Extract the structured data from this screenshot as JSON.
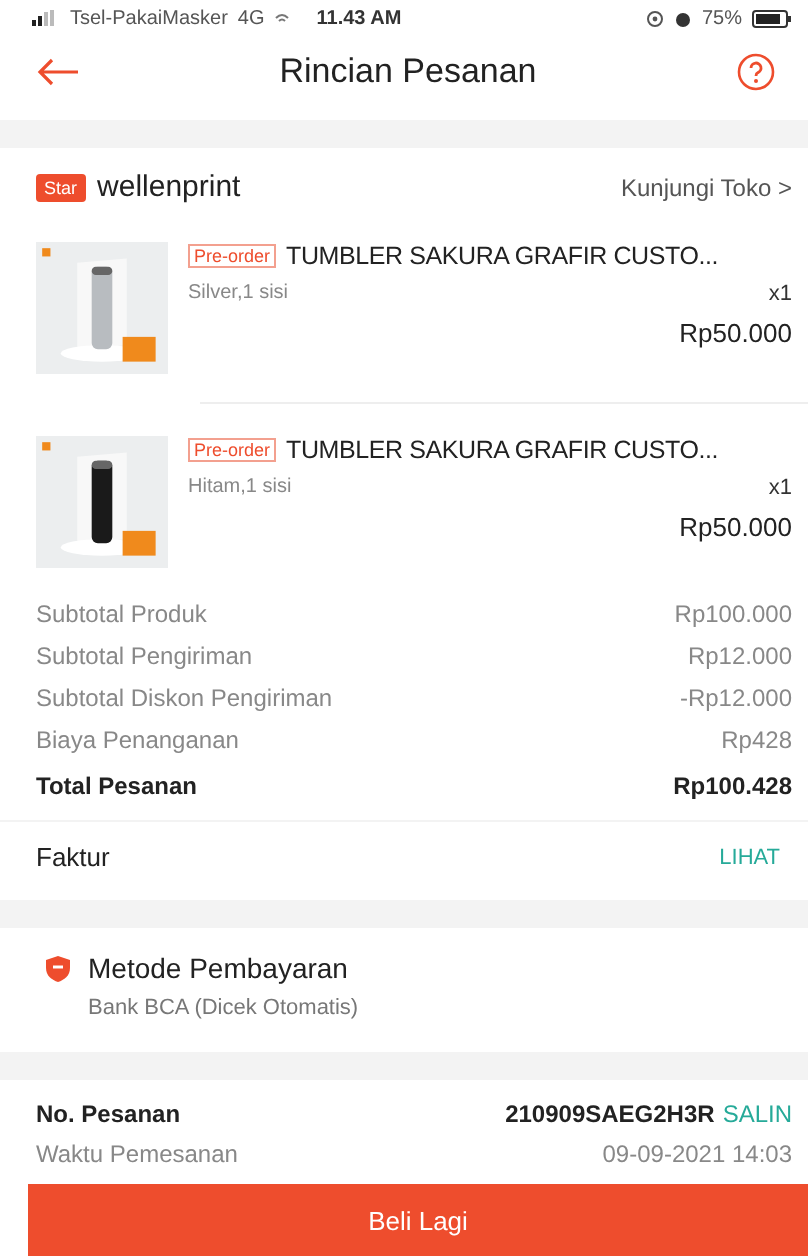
{
  "status_bar": {
    "carrier": "Tsel-PakaiMasker",
    "network": "4G",
    "time": "11.43 AM",
    "battery": "75%"
  },
  "header": {
    "title": "Rincian Pesanan"
  },
  "shop": {
    "badge": "Star",
    "name": "wellenprint",
    "link": "Kunjungi Toko",
    "chevron": ">"
  },
  "products": [
    {
      "tag": "Pre-order",
      "title": "TUMBLER SAKURA GRAFIR CUSTO...",
      "variant": "Silver,1 sisi",
      "qty": "x1",
      "price": "Rp50.000",
      "kind": "picture"
    },
    {
      "tag": "Pre-order",
      "title": "TUMBLER SAKURA GRAFIR CUSTO...",
      "variant": "Hitam,1 sisi",
      "qty": "x1",
      "price": "Rp50.000",
      "kind": "picture"
    }
  ],
  "summary": [
    {
      "kind": "line",
      "label": "Subtotal Produk",
      "value": "Rp100.000"
    },
    {
      "kind": "line",
      "label": "Subtotal Pengiriman",
      "value": "Rp12.000"
    },
    {
      "kind": "line",
      "label": "Subtotal Diskon Pengiriman",
      "value": "-Rp12.000"
    },
    {
      "kind": "line",
      "label": "Biaya Penanganan",
      "value": "Rp428"
    },
    {
      "kind": "total",
      "label": "Total Pesanan",
      "value": "Rp100.428"
    }
  ],
  "invoice": {
    "label": "Faktur",
    "action": "LIHAT"
  },
  "payment": {
    "title": "Metode Pembayaran",
    "method": "Bank BCA (Dicek Otomatis)"
  },
  "order": [
    {
      "kind": "id",
      "label": "No. Pesanan",
      "value": "210909SAEG2H3R",
      "action": "SALIN"
    },
    {
      "kind": "time",
      "label": "Waktu Pemesanan",
      "value": "09-09-2021 14:03"
    }
  ],
  "button": "Beli Lagi"
}
